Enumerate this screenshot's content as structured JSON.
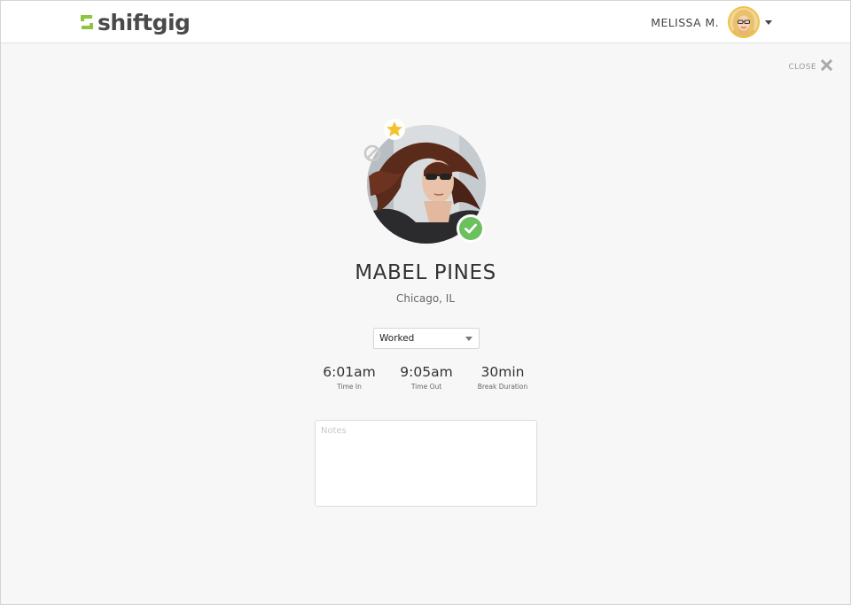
{
  "header": {
    "brand": "shiftgig",
    "user_name": "MELISSA M."
  },
  "close": {
    "label": "CLOSE"
  },
  "profile": {
    "name": "MABEL PINES",
    "location": "Chicago, IL"
  },
  "status": {
    "selected": "Worked"
  },
  "stats": [
    {
      "value": "6:01am",
      "label": "Time In"
    },
    {
      "value": "9:05am",
      "label": "Time Out"
    },
    {
      "value": "30min",
      "label": "Break Duration"
    }
  ],
  "notes": {
    "placeholder": "Notes"
  },
  "colors": {
    "brand_green": "#8cc63f",
    "check_green": "#6cc05e",
    "star_yellow": "#f5c12e",
    "background": "#f7f7f7"
  }
}
